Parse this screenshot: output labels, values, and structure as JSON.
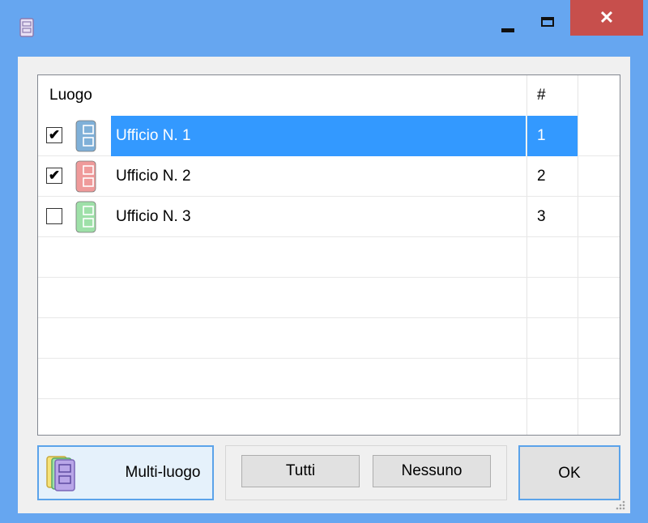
{
  "window": {
    "title": "",
    "controls": {
      "minimize": "",
      "maximize": "",
      "close": "✕"
    }
  },
  "grid": {
    "columns": [
      "Luogo",
      "#"
    ],
    "rows": [
      {
        "name": "Ufficio N. 1",
        "num": "1",
        "checked": true,
        "selected": true,
        "color": "#7fb0d8"
      },
      {
        "name": "Ufficio N. 2",
        "num": "2",
        "checked": true,
        "selected": false,
        "color": "#ef9a9a"
      },
      {
        "name": "Ufficio N. 3",
        "num": "3",
        "checked": false,
        "selected": false,
        "color": "#9ee0a8"
      }
    ]
  },
  "buttons": {
    "multi": "Multi-luogo",
    "tutti": "Tutti",
    "nessuno": "Nessuno",
    "ok": "OK"
  },
  "colors": {
    "titlebar": "#66a6f0",
    "close": "#c74f4c",
    "selection": "#3399ff",
    "focus_border": "#5ba3ea"
  }
}
